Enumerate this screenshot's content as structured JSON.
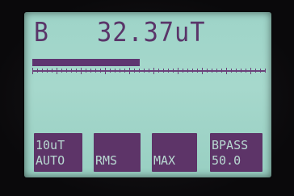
{
  "display": {
    "channel": "B",
    "reading": "32.37uT",
    "bar_fill_fraction": 0.46
  },
  "softkeys": [
    {
      "line1": "10uT",
      "line2": "AUTO"
    },
    {
      "line1": "",
      "line2": "RMS"
    },
    {
      "line1": "",
      "line2": "MAX"
    },
    {
      "line1": "BPASS",
      "line2": "50.0"
    }
  ],
  "colors": {
    "lcd_background": "#a6d8cc",
    "lcd_ink": "#5a3569",
    "softkey_background": "#5d3468",
    "softkey_text": "#b9d9d2"
  }
}
